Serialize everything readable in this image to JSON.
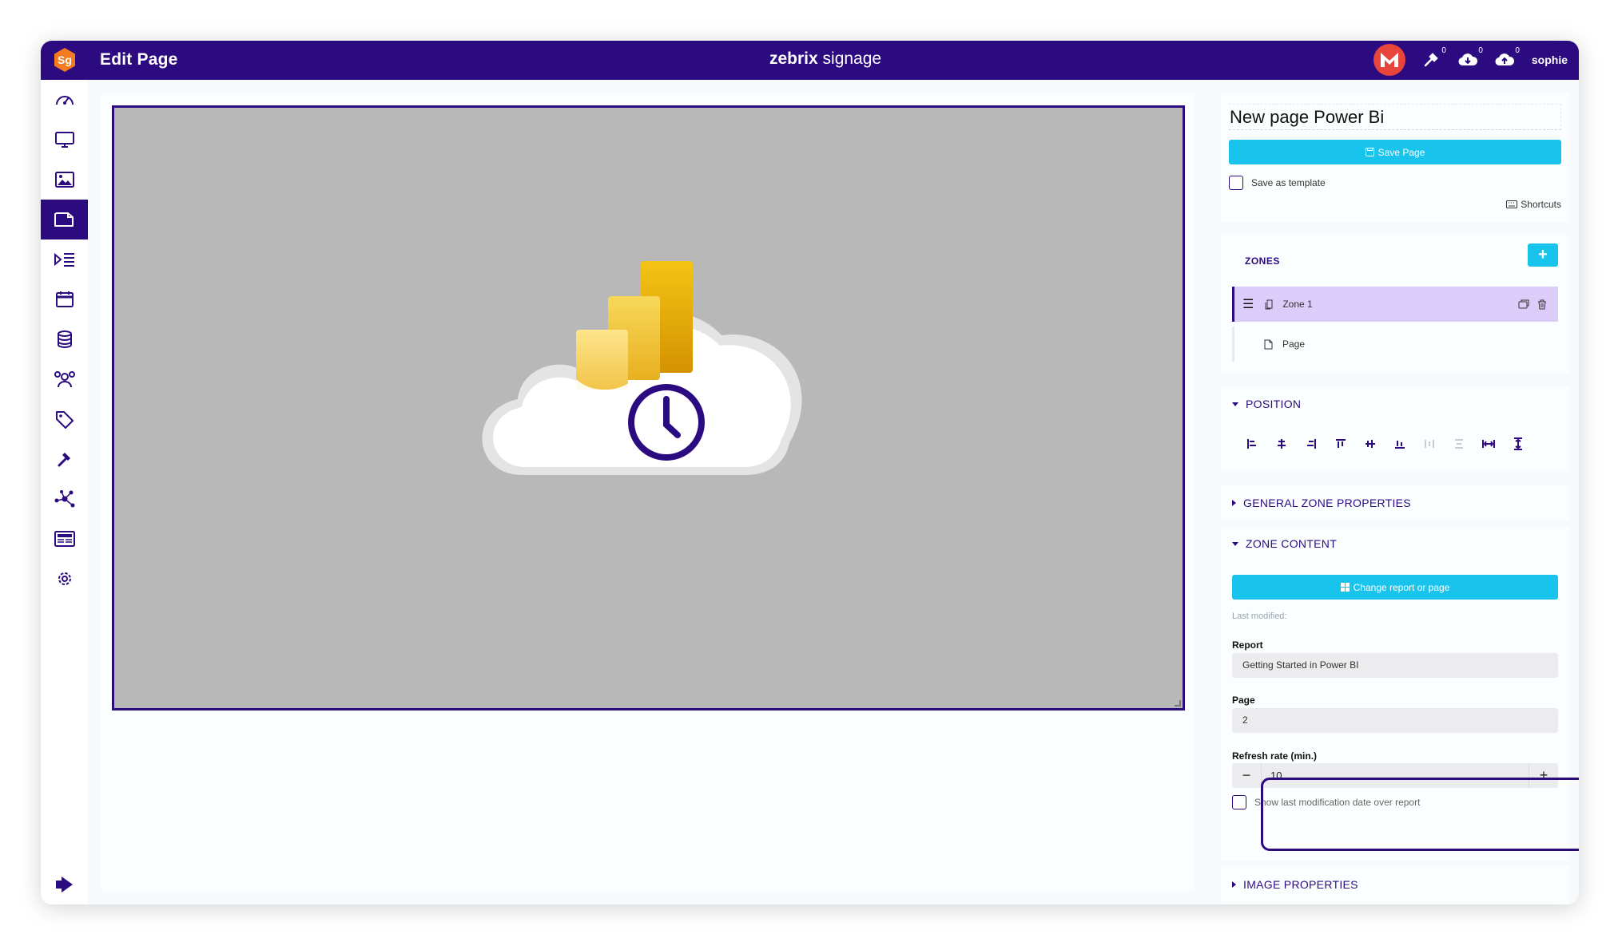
{
  "header": {
    "title": "Edit Page",
    "brand_bold": "zebrix",
    "brand_rest": " signage",
    "user": "sophie",
    "counts": {
      "tools": "0",
      "download": "0",
      "upload": "0"
    }
  },
  "logo": {
    "text": "Sg",
    "color": "#f47b20"
  },
  "sidebar": {
    "items": [
      {
        "name": "dashboard-icon"
      },
      {
        "name": "monitor-icon"
      },
      {
        "name": "image-icon"
      },
      {
        "name": "page-icon",
        "active": true
      },
      {
        "name": "playlist-icon"
      },
      {
        "name": "calendar-icon"
      },
      {
        "name": "database-icon"
      },
      {
        "name": "users-icon"
      },
      {
        "name": "tag-icon"
      },
      {
        "name": "tools-icon"
      },
      {
        "name": "network-icon"
      },
      {
        "name": "news-icon"
      },
      {
        "name": "settings-icon"
      }
    ],
    "logout": "logout-icon"
  },
  "editor": {
    "page_name": "New page Power Bi",
    "save_label": "Save Page",
    "save_template_label": "Save as template",
    "shortcuts_label": "Shortcuts"
  },
  "zones": {
    "title": "ZONES",
    "add_label": "+",
    "items": [
      {
        "label": "Zone 1"
      },
      {
        "label": "Page"
      }
    ]
  },
  "position": {
    "title": "POSITION"
  },
  "general": {
    "title": "GENERAL ZONE PROPERTIES"
  },
  "zone_content": {
    "title": "ZONE CONTENT",
    "change_label": "Change report or page",
    "last_modified_label": "Last modified:",
    "report_label": "Report",
    "report_value": "Getting Started in Power BI",
    "page_label": "Page",
    "page_value": "2",
    "refresh_label": "Refresh rate (min.)",
    "refresh_value": "10",
    "minus_label": "−",
    "plus_label": "+",
    "show_last_mod_label": "Show last modification date over report"
  },
  "image_props": {
    "title": "IMAGE PROPERTIES"
  },
  "colors": {
    "primary": "#2c0a80",
    "accent": "#19c4ec",
    "zone_selected": "#dcccf9",
    "canvas": "#b8b8b8"
  }
}
